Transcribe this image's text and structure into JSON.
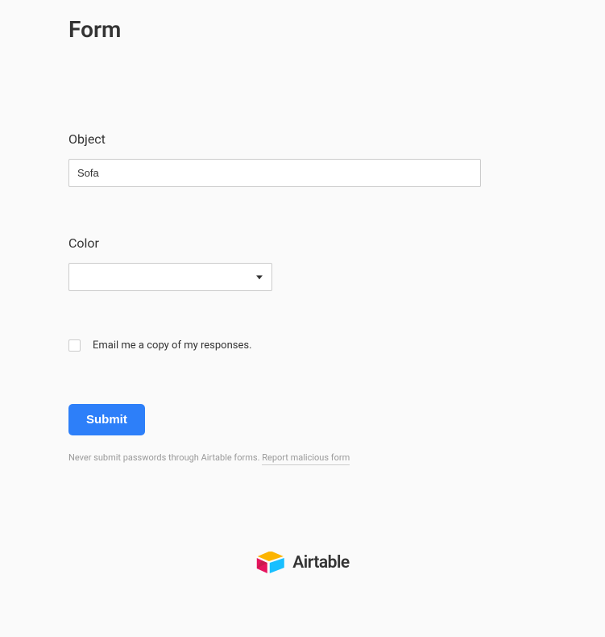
{
  "form": {
    "title": "Form",
    "fields": {
      "object": {
        "label": "Object",
        "value": "Sofa"
      },
      "color": {
        "label": "Color",
        "value": ""
      },
      "emailCopy": {
        "label": "Email me a copy of my responses."
      }
    },
    "submit_label": "Submit",
    "warning_text": "Never submit passwords through Airtable forms. ",
    "report_link": "Report malicious form"
  },
  "brand": {
    "name": "Airtable"
  }
}
